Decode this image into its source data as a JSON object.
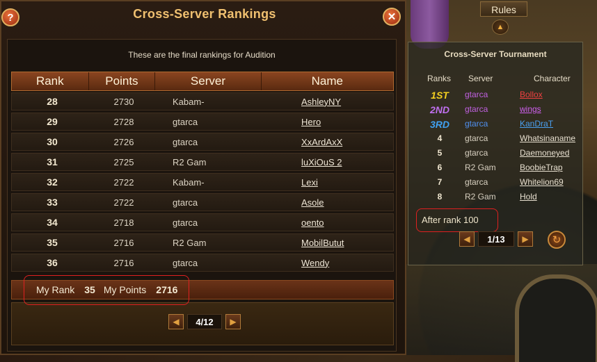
{
  "main": {
    "title": "Cross-Server Rankings",
    "help_glyph": "?",
    "close_glyph": "✕",
    "subtitle": "These are the final rankings for Audition",
    "columns": [
      "Rank",
      "Points",
      "Server",
      "Name"
    ],
    "rows": [
      {
        "rank": "28",
        "points": "2730",
        "server": "Kabam-",
        "name": "AshleyNY"
      },
      {
        "rank": "29",
        "points": "2728",
        "server": "gtarca",
        "name": "Hero"
      },
      {
        "rank": "30",
        "points": "2726",
        "server": "gtarca",
        "name": "XxArdAxX"
      },
      {
        "rank": "31",
        "points": "2725",
        "server": "R2 Gam",
        "name": "luXiOuS 2"
      },
      {
        "rank": "32",
        "points": "2722",
        "server": "Kabam-",
        "name": "Lexi"
      },
      {
        "rank": "33",
        "points": "2722",
        "server": "gtarca",
        "name": "Asole"
      },
      {
        "rank": "34",
        "points": "2718",
        "server": "gtarca",
        "name": "oento"
      },
      {
        "rank": "35",
        "points": "2716",
        "server": "R2 Gam",
        "name": "MobilButut"
      },
      {
        "rank": "36",
        "points": "2716",
        "server": "gtarca",
        "name": "Wendy"
      }
    ],
    "my_rank_label": "My Rank",
    "my_rank_value": "35",
    "my_points_label": "My Points",
    "my_points_value": "2716",
    "page": "4/12",
    "prev_glyph": "◀",
    "next_glyph": "▶"
  },
  "side": {
    "rules_label": "Rules",
    "up_glyph": "▲",
    "title": "Cross-Server Tournament",
    "headers": {
      "ranks": "Ranks",
      "server": "Server",
      "character": "Character"
    },
    "rows": [
      {
        "rank": "1ST",
        "server": "gtarca",
        "character": "Bollox",
        "rank_color": "#f5d020",
        "server_color": "#c060e0",
        "char_color": "#f04040"
      },
      {
        "rank": "2ND",
        "server": "gtarca",
        "character": "wings",
        "rank_color": "#c070f0",
        "server_color": "#c060e0",
        "char_color": "#d060f0"
      },
      {
        "rank": "3RD",
        "server": "gtarca",
        "character": "KanDraT",
        "rank_color": "#40a0f0",
        "server_color": "#5090f0",
        "char_color": "#4aa0f0"
      },
      {
        "rank": "4",
        "server": "gtarca",
        "character": "Whatsinaname",
        "rank_color": "#f0e6d0",
        "server_color": "#d8d0c0",
        "char_color": "#e8e0d0"
      },
      {
        "rank": "5",
        "server": "gtarca",
        "character": "Daemoneyed",
        "rank_color": "#f0e6d0",
        "server_color": "#d8d0c0",
        "char_color": "#e8e0d0"
      },
      {
        "rank": "6",
        "server": "R2 Gam",
        "character": "BoobieTrap",
        "rank_color": "#f0e6d0",
        "server_color": "#d8d0c0",
        "char_color": "#e8e0d0"
      },
      {
        "rank": "7",
        "server": "gtarca",
        "character": "Whitelion69",
        "rank_color": "#f0e6d0",
        "server_color": "#d8d0c0",
        "char_color": "#e8e0d0"
      },
      {
        "rank": "8",
        "server": "R2 Gam",
        "character": "Hold",
        "rank_color": "#f0e6d0",
        "server_color": "#d8d0c0",
        "char_color": "#e8e0d0"
      }
    ],
    "after_rank": "After rank 100",
    "page": "1/13",
    "prev_glyph": "◀",
    "next_glyph": "▶",
    "refresh_glyph": "↻"
  }
}
